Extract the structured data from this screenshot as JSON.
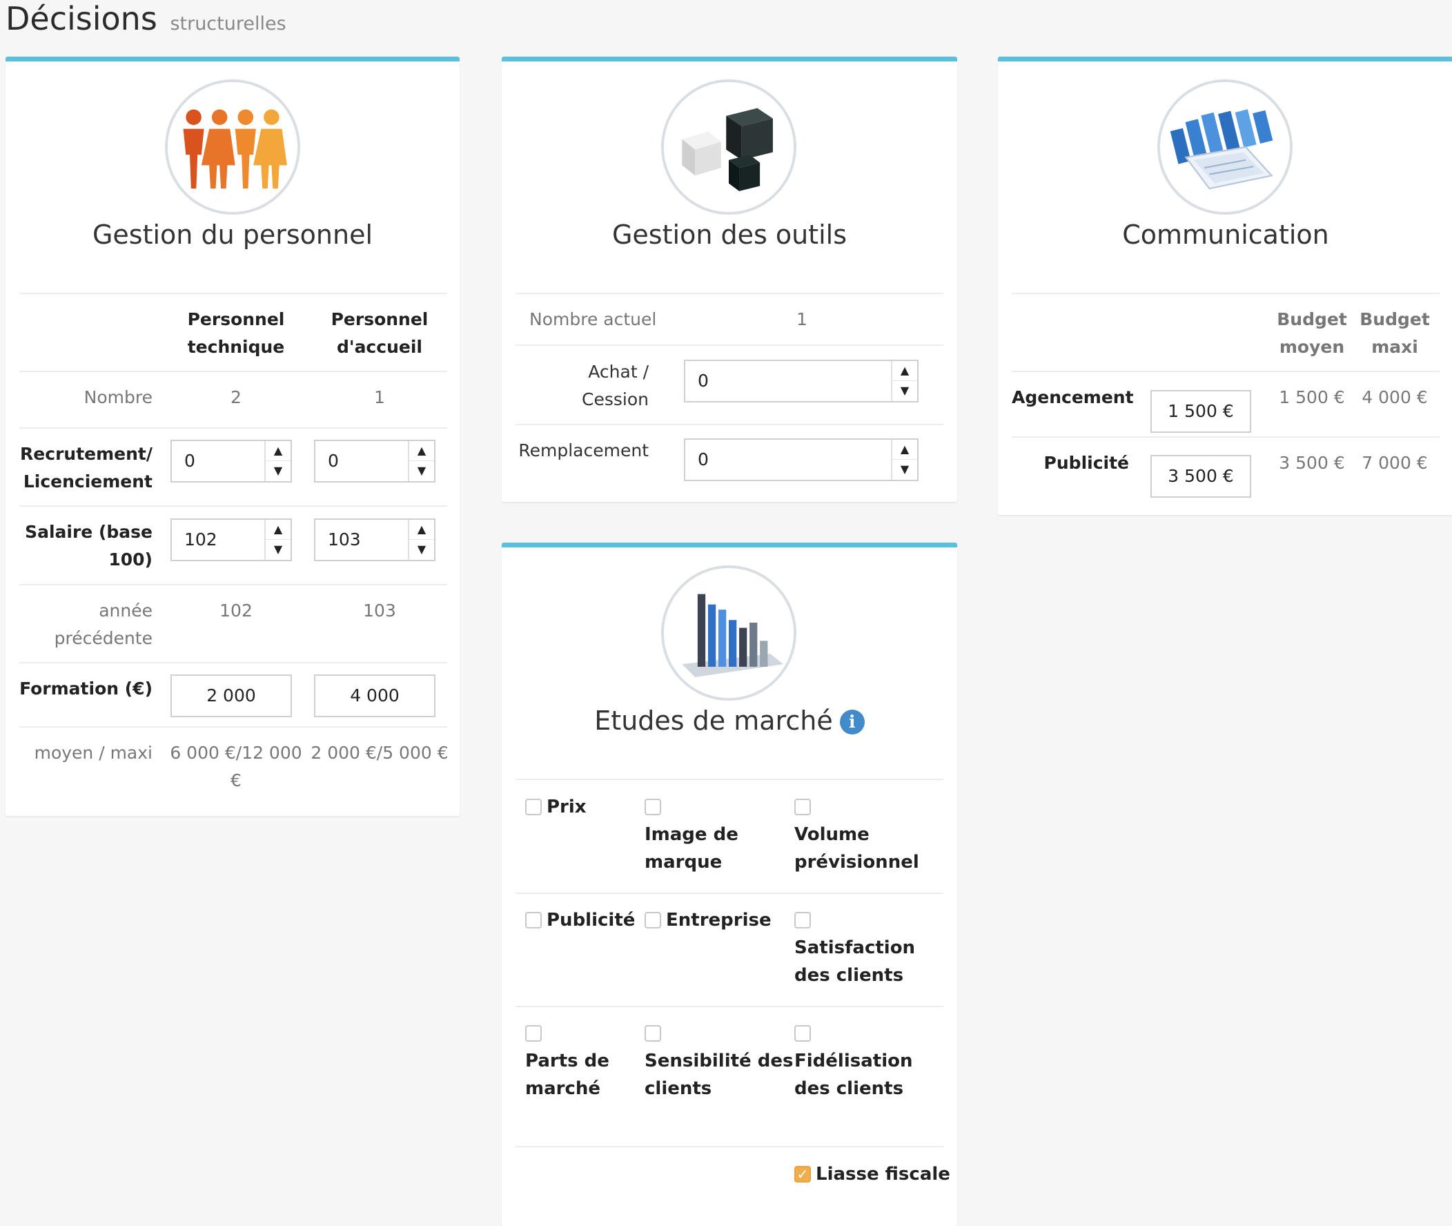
{
  "page": {
    "title": "Décisions",
    "subtitle": "structurelles"
  },
  "personnel": {
    "title": "Gestion du personnel",
    "icon": "people-icon",
    "columns": [
      "Personnel\ntechnique",
      "Personnel\nd'accueil"
    ],
    "rows": {
      "nombre": {
        "label": "Nombre",
        "values": [
          "2",
          "1"
        ]
      },
      "recrutement": {
        "label": "Recrutement/\nLicenciement",
        "values": [
          "0",
          "0"
        ]
      },
      "salaire": {
        "label": "Salaire (base\n100)",
        "values": [
          "102",
          "103"
        ]
      },
      "annee": {
        "label": "année\nprécédente",
        "values": [
          "102",
          "103"
        ]
      },
      "formation": {
        "label": "Formation (€)",
        "values": [
          "2 000",
          "4 000"
        ]
      },
      "moyen": {
        "label": "moyen / maxi",
        "values": [
          "6 000 €/12 000\n€",
          "2 000 €/5 000 €"
        ]
      }
    }
  },
  "outils": {
    "title": "Gestion des outils",
    "icon": "cubes-icon",
    "rows": {
      "nombre": {
        "label": "Nombre actuel",
        "value": "1"
      },
      "achat": {
        "label": "Achat /\nCession",
        "value": "0"
      },
      "remplacement": {
        "label": "Remplacement",
        "value": "0"
      }
    }
  },
  "communication": {
    "title": "Communication",
    "icon": "documents-icon",
    "columns": [
      "Budget\nmoyen",
      "Budget\nmaxi"
    ],
    "rows": {
      "agencement": {
        "label": "Agencement",
        "value": "1 500 €",
        "moyen": "1 500 €",
        "maxi": "4 000 €"
      },
      "publicite": {
        "label": "Publicité",
        "value": "3 500 €",
        "moyen": "3 500 €",
        "maxi": "7 000 €"
      }
    }
  },
  "etudes": {
    "title": "Etudes de marché",
    "icon": "bar-chart-icon",
    "info_icon": "i",
    "options": [
      {
        "label": "Prix",
        "checked": false
      },
      {
        "label": "Image de\nmarque",
        "checked": false
      },
      {
        "label": "Volume\nprévisionnel",
        "checked": false
      },
      {
        "label": "Publicité",
        "checked": false
      },
      {
        "label": "Entreprise",
        "checked": false
      },
      {
        "label": "Satisfaction\ndes clients",
        "checked": false
      },
      {
        "label": "Parts de\nmarché",
        "checked": false
      },
      {
        "label": "Sensibilité des\nclients",
        "checked": false
      },
      {
        "label": "Fidélisation\ndes clients",
        "checked": false
      }
    ],
    "liasse": {
      "label": "Liasse fiscale",
      "checked": true,
      "check_glyph": "✓"
    }
  },
  "spinner": {
    "up": "▲",
    "down": "▼"
  },
  "colors": {
    "panel_border": "#5bc0de",
    "info_icon": "#428bca",
    "checkbox_checked": "#f0ad4e"
  }
}
